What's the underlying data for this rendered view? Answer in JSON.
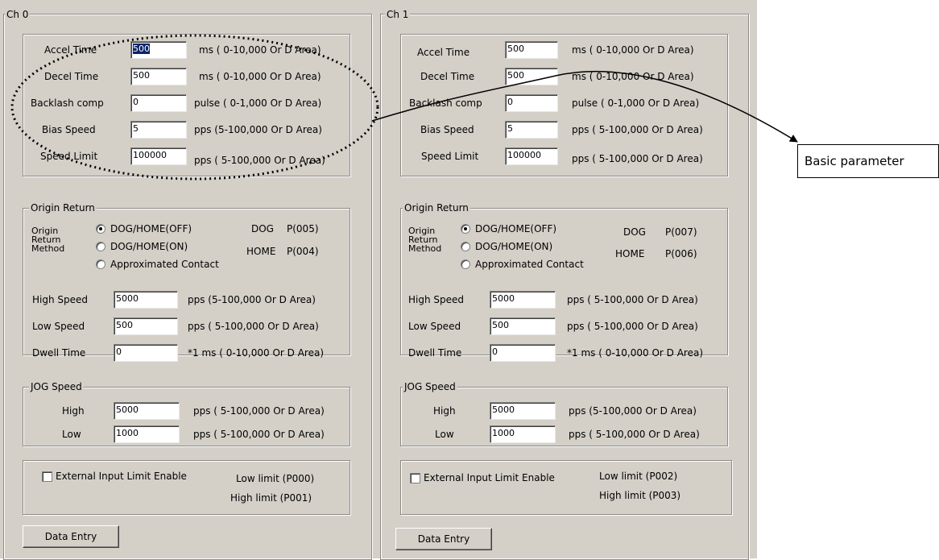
{
  "channels": [
    {
      "title": "Ch 0",
      "basic": [
        {
          "label": "Accel Time",
          "value": "500",
          "range": "ms ( 0-10,000 Or D Area)"
        },
        {
          "label": "Decel Time",
          "value": "500",
          "range": "ms ( 0-10,000 Or D Area)"
        },
        {
          "label": "Backlash comp",
          "value": "0",
          "range": "pulse ( 0-1,000 Or D Area)"
        },
        {
          "label": "Bias Speed",
          "value": "5",
          "range": "pps (5-100,000 Or D Area)"
        },
        {
          "label": "Speed Limit",
          "value": "100000",
          "range": "pps ( 5-100,000 Or D Area)"
        }
      ],
      "origin": {
        "title": "Origin Return",
        "method_label": "Origin Return Method",
        "options": [
          "DOG/HOME(OFF)",
          "DOG/HOME(ON)",
          "Approximated Contact"
        ],
        "selected": 0,
        "dog_label": "DOG",
        "dog_value": "P(005)",
        "home_label": "HOME",
        "home_value": "P(004)",
        "fields": [
          {
            "label": "High Speed",
            "value": "5000",
            "range": "pps (5-100,000 Or D Area)"
          },
          {
            "label": "Low Speed",
            "value": "500",
            "range": "pps ( 5-100,000 Or D Area)"
          },
          {
            "label": "Dwell Time",
            "value": "0",
            "range": "*1 ms ( 0-10,000 Or D Area)"
          }
        ]
      },
      "jog": {
        "title": "JOG Speed",
        "fields": [
          {
            "label": "High",
            "value": "5000",
            "range": "pps ( 5-100,000 Or D Area)"
          },
          {
            "label": "Low",
            "value": "1000",
            "range": "pps ( 5-100,000 Or D Area)"
          }
        ]
      },
      "ext": {
        "checkbox_label": "External Input Limit Enable",
        "low_limit": "Low limit (P000)",
        "high_limit": "High limit (P001)"
      },
      "button": "Data Entry"
    },
    {
      "title": "Ch 1",
      "basic": [
        {
          "label": "Accel Time",
          "value": "500",
          "range": "ms ( 0-10,000 Or D Area)"
        },
        {
          "label": "Decel Time",
          "value": "500",
          "range": "ms ( 0-10,000 Or D Area)"
        },
        {
          "label": "Backlash comp",
          "value": "0",
          "range": "pulse ( 0-1,000 Or D Area)"
        },
        {
          "label": "Bias Speed",
          "value": "5",
          "range": "pps ( 5-100,000 Or D Area)"
        },
        {
          "label": "Speed Limit",
          "value": "100000",
          "range": "pps ( 5-100,000 Or D Area)"
        }
      ],
      "origin": {
        "title": "Origin Return",
        "method_label": "Origin Return Method",
        "options": [
          "DOG/HOME(OFF)",
          "DOG/HOME(ON)",
          "Approximated Contact"
        ],
        "selected": 0,
        "dog_label": "DOG",
        "dog_value": "P(007)",
        "home_label": "HOME",
        "home_value": "P(006)",
        "fields": [
          {
            "label": "High Speed",
            "value": "5000",
            "range": "pps ( 5-100,000 Or D Area)"
          },
          {
            "label": "Low Speed",
            "value": "500",
            "range": "pps ( 5-100,000 Or D Area)"
          },
          {
            "label": "Dwell Time",
            "value": "0",
            "range": "*1 ms ( 0-10,000 Or D Area)"
          }
        ]
      },
      "jog": {
        "title": "JOG Speed",
        "fields": [
          {
            "label": "High",
            "value": "5000",
            "range": "pps (5-100,000 Or D Area)"
          },
          {
            "label": "Low",
            "value": "1000",
            "range": "pps ( 5-100,000 Or D Area)"
          }
        ]
      },
      "ext": {
        "checkbox_label": "External Input Limit Enable",
        "low_limit": "Low limit (P002)",
        "high_limit": "High limit (P003)"
      },
      "button": "Data Entry"
    }
  ],
  "callout": "Basic parameter"
}
